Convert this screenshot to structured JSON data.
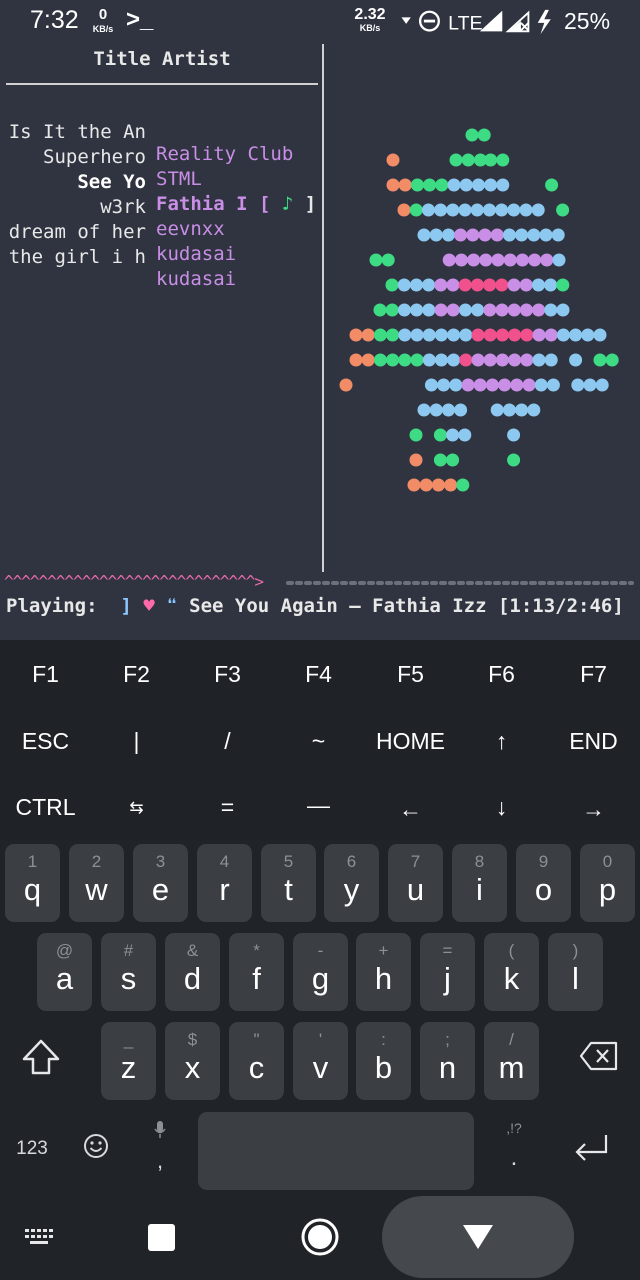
{
  "status_bar": {
    "time": "7:32",
    "net_left_value": "0",
    "net_left_unit": "KB/s",
    "terminal_glyph": ">_",
    "net_right_value": "2.32",
    "net_right_unit": "KB/s",
    "network": "LTE",
    "battery": "25%"
  },
  "terminal": {
    "header": "Title Artist",
    "rows": [
      {
        "title": "Is It the An",
        "artist": "Reality Club"
      },
      {
        "title": "Superhero",
        "artist": "STML"
      },
      {
        "title": "See Yo",
        "artist": "Fathia I [",
        "marker": "♪",
        "marker_end": "]"
      },
      {
        "title": "w3rk",
        "artist": "eevnxx"
      },
      {
        "title": "dream of her",
        "artist": "kudasai"
      },
      {
        "title": "the girl i h",
        "artist": "kudasai"
      }
    ],
    "wave": "^^^^^^^^^^^^^^^^^^^^^^^^^^^^^>",
    "playing_label": "Playing:",
    "playing_bracket": "]",
    "playing_heart": "♥",
    "playing_quote": "❝",
    "playing_text": "See You Again – Fathia Izz [1:13/2:46]"
  },
  "extra_keys": {
    "row1": [
      "F1",
      "F2",
      "F3",
      "F4",
      "F5",
      "F6",
      "F7"
    ],
    "row2": [
      "ESC",
      "|",
      "/",
      "~",
      "HOME",
      "↑",
      "END"
    ],
    "row3": [
      "CTRL",
      "⇆",
      "=",
      "—",
      "←",
      "↓",
      "→"
    ]
  },
  "keyboard": {
    "row1": [
      {
        "hint": "1",
        "key": "q"
      },
      {
        "hint": "2",
        "key": "w"
      },
      {
        "hint": "3",
        "key": "e"
      },
      {
        "hint": "4",
        "key": "r"
      },
      {
        "hint": "5",
        "key": "t"
      },
      {
        "hint": "6",
        "key": "y"
      },
      {
        "hint": "7",
        "key": "u"
      },
      {
        "hint": "8",
        "key": "i"
      },
      {
        "hint": "9",
        "key": "o"
      },
      {
        "hint": "0",
        "key": "p"
      }
    ],
    "row2": [
      {
        "hint": "@",
        "key": "a"
      },
      {
        "hint": "#",
        "key": "s"
      },
      {
        "hint": "&",
        "key": "d"
      },
      {
        "hint": "*",
        "key": "f"
      },
      {
        "hint": "-",
        "key": "g"
      },
      {
        "hint": "+",
        "key": "h"
      },
      {
        "hint": "=",
        "key": "j"
      },
      {
        "hint": "(",
        "key": "k"
      },
      {
        "hint": ")",
        "key": "l"
      }
    ],
    "row3": [
      {
        "hint": "_",
        "key": "z"
      },
      {
        "hint": "$",
        "key": "x"
      },
      {
        "hint": "\"",
        "key": "c"
      },
      {
        "hint": "'",
        "key": "v"
      },
      {
        "hint": ":",
        "key": "b"
      },
      {
        "hint": ";",
        "key": "n"
      },
      {
        "hint": "/",
        "key": "m"
      }
    ],
    "num_label": "123",
    "comma": ",",
    "period": ".",
    "period_hint": ",!?"
  },
  "colors": {
    "bg": "#2f3440",
    "artist": "#c98ee6",
    "dot_orange": "#f28c66",
    "dot_green": "#3ddc84",
    "dot_blue": "#8cc8f0",
    "dot_purple": "#c98ee6",
    "dot_pink": "#f0508c"
  }
}
